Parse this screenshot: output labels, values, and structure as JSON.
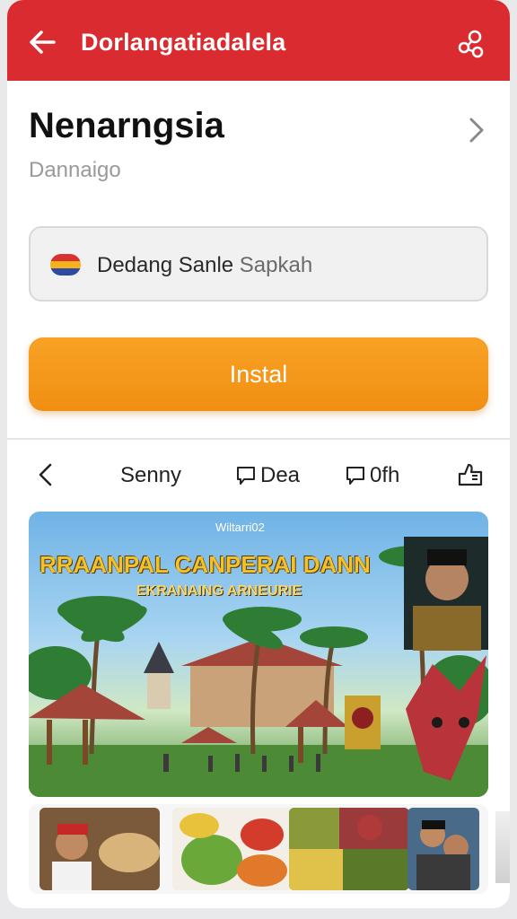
{
  "header": {
    "title": "Dorlangatiadalela",
    "back_icon": "arrow-left-icon",
    "share_icon": "share-icon",
    "color": "#d92b30"
  },
  "app": {
    "name": "Nenarngsia",
    "subtitle": "Dannaigo"
  },
  "language": {
    "primary": "Dedang Sanle",
    "secondary": "Sapkah"
  },
  "install": {
    "label": "Instal",
    "color": "#f39214"
  },
  "tabs": [
    {
      "label": "Senny"
    },
    {
      "label": "Dea",
      "icon": "chat-icon"
    },
    {
      "label": "0fh",
      "icon": "chat-icon"
    }
  ],
  "hero": {
    "tag": "Wiltarri02",
    "headline": "RRAANPAL CANPERAI DANN",
    "subheadline": "EKRANAING ARNEURIE"
  }
}
